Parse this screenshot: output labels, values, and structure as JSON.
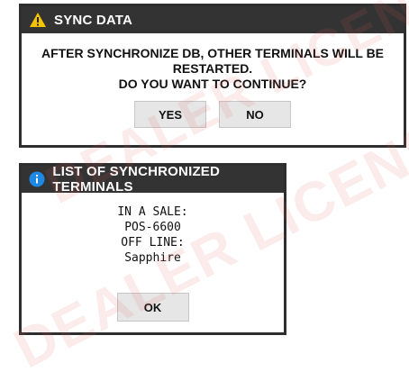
{
  "sync_dialog": {
    "title": "SYNC DATA",
    "icon": "warning-icon",
    "message_lines": [
      "AFTER SYNCHRONIZE DB, OTHER TERMINALS WILL BE",
      "RESTARTED.",
      "DO YOU WANT TO CONTINUE?"
    ],
    "yes_label": "YES",
    "no_label": "NO"
  },
  "terminals_dialog": {
    "title": "LIST OF SYNCHRONIZED TERMINALS",
    "icon": "info-icon",
    "lines": [
      "IN A SALE:",
      "POS-6600",
      "OFF LINE:",
      "Sapphire"
    ],
    "ok_label": "OK"
  },
  "watermark": {
    "text_1": "DEALER LICENSE",
    "text_2": "DEALER LICENSE"
  },
  "colors": {
    "titlebar": "#333333",
    "warning": "#f5c400",
    "info": "#1e88e5",
    "button": "#e6e6e6"
  }
}
